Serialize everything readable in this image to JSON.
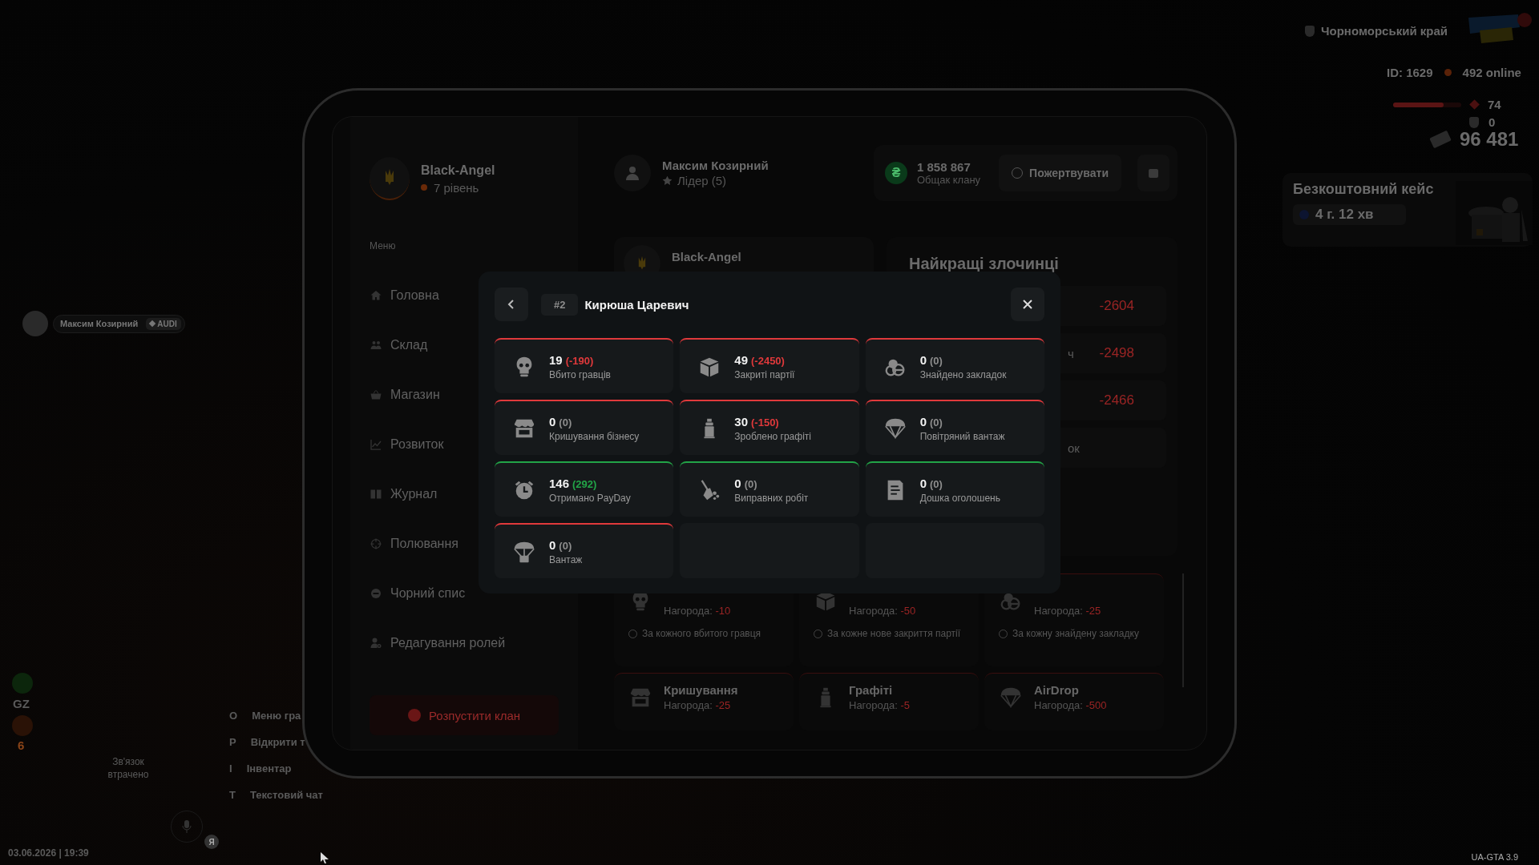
{
  "hud": {
    "region": "Чорноморський край",
    "player_id": "ID: 1629",
    "online": "492 online",
    "health": {
      "level": 0.74,
      "reading": "74"
    },
    "armor": "0",
    "money": "96 481",
    "case_title": "Безкоштовний кейс",
    "case_timer": "4 г. 12 хв"
  },
  "player_tag": {
    "name": "Максим Козирний",
    "vehicle": "AUDI"
  },
  "status": {
    "zone": "GZ",
    "wanted": "6",
    "voice": "Зв'язок втрачено",
    "mic_badge": "Я"
  },
  "hotkeys": [
    {
      "key": "O",
      "label": "Меню гра"
    },
    {
      "key": "P",
      "label": "Відкрити т"
    },
    {
      "key": "I",
      "label": "Інвентар"
    },
    {
      "key": "T",
      "label": "Текстовий чат"
    }
  ],
  "datetime": "03.06.2026 | 19:39",
  "version": "UA-GTA 3.9",
  "tablet": {
    "clan": {
      "name": "Black-Angel",
      "level": "7 рівень"
    },
    "menu_title": "Меню",
    "menu": [
      {
        "label": "Головна",
        "kind": "home"
      },
      {
        "label": "Склад",
        "kind": "people"
      },
      {
        "label": "Магазин",
        "kind": "basket"
      },
      {
        "label": "Розвиток",
        "kind": "chart"
      },
      {
        "label": "Журнал",
        "kind": "book"
      },
      {
        "label": "Полювання",
        "kind": "target"
      },
      {
        "label": "Чорний спис",
        "kind": "minus"
      },
      {
        "label": "Редагування ролей",
        "kind": "usergear"
      }
    ],
    "disband": "Розпустити клан",
    "member": {
      "name": "Максим Козирний",
      "role": "Лідер (5)"
    },
    "treasury": {
      "symbol": "₴",
      "amount": "1 858 867",
      "label": "Общак клану"
    },
    "donate": "Пожертвувати",
    "clan_card": {
      "name": "Black-Angel"
    },
    "top_criminals": {
      "title": "Найкращі злочинці",
      "rows": [
        {
          "score": "-2604"
        },
        {
          "name": "ч",
          "score": "-2498"
        },
        {
          "score": "-2466"
        },
        {
          "name": "ок"
        }
      ]
    },
    "rewards": [
      {
        "kind": "skull",
        "reward_label": "Нагорода:",
        "reward": "-10",
        "note": "За кожного вбитого гравця"
      },
      {
        "kind": "box",
        "reward_label": "Нагорода:",
        "reward": "-50",
        "note": "За кожне нове закриття партії"
      },
      {
        "kind": "pills",
        "reward_label": "Нагорода:",
        "reward": "-25",
        "note": "За кожну знайдену закладку"
      },
      {
        "kind": "shop",
        "title": "Кришування",
        "reward_label": "Нагорода:",
        "reward": "-25"
      },
      {
        "kind": "spray",
        "title": "Графіті",
        "reward_label": "Нагорода:",
        "reward": "-5"
      },
      {
        "kind": "parachute",
        "title": "AirDrop",
        "reward_label": "Нагорода:",
        "reward": "-500"
      }
    ]
  },
  "modal": {
    "rank": "#2",
    "name": "Кирюша Царевич",
    "stats": [
      {
        "kind": "skull",
        "value": "19",
        "delta": "(-190)",
        "label": "Вбито гравців",
        "color": "#e0393b",
        "delta_highlighted": true
      },
      {
        "kind": "box",
        "value": "49",
        "delta": "(-2450)",
        "label": "Закриті партії",
        "color": "#e0393b",
        "delta_highlighted": true
      },
      {
        "kind": "pills",
        "value": "0",
        "delta": "(0)",
        "label": "Знайдено закладок",
        "color": "#e0393b",
        "delta_highlighted": false
      },
      {
        "kind": "shop",
        "value": "0",
        "delta": "(0)",
        "label": "Кришування бізнесу",
        "color": "#e0393b",
        "delta_highlighted": false
      },
      {
        "kind": "spray",
        "value": "30",
        "delta": "(-150)",
        "label": "Зроблено графіті",
        "color": "#e0393b",
        "delta_highlighted": true
      },
      {
        "kind": "parachute",
        "value": "0",
        "delta": "(0)",
        "label": "Повітряний вантаж",
        "color": "#e0393b",
        "delta_highlighted": false
      },
      {
        "kind": "clock",
        "value": "146",
        "delta": "(292)",
        "label": "Отримано PayDay",
        "color": "#22a447",
        "delta_highlighted": true
      },
      {
        "kind": "broom",
        "value": "0",
        "delta": "(0)",
        "label": "Виправних робіт",
        "color": "#22a447",
        "delta_highlighted": false
      },
      {
        "kind": "board",
        "value": "0",
        "delta": "(0)",
        "label": "Дошка оголошень",
        "color": "#22a447",
        "delta_highlighted": false
      },
      {
        "kind": "cargo",
        "value": "0",
        "delta": "(0)",
        "label": "Вантаж",
        "color": "#e0393b",
        "delta_highlighted": false
      },
      {
        "kind": "empty"
      },
      {
        "kind": "empty"
      }
    ]
  }
}
